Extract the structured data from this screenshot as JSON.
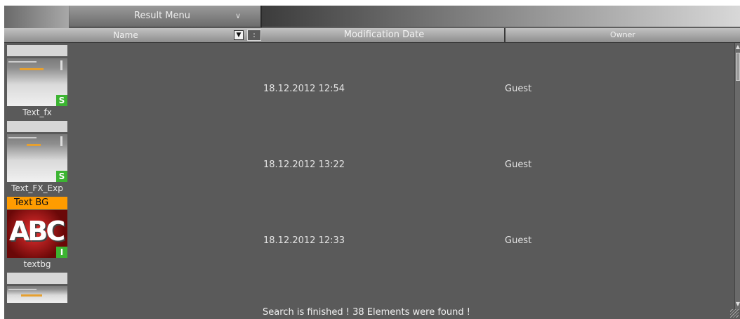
{
  "toolbar": {
    "result_menu_label": "Result Menu",
    "result_menu_icon": "chevron-down-icon"
  },
  "columns": {
    "name": "Name",
    "sort_icon": "triangle-down-icon",
    "modification_date": "Modification Date",
    "owner": "Owner"
  },
  "items": [
    {
      "caption": "Text_fx",
      "badge": "S",
      "date": "18.12.2012 12:54",
      "owner": "Guest"
    },
    {
      "caption": "Text_FX_Exp",
      "badge": "S",
      "date": "18.12.2012 13:22",
      "owner": "Guest"
    },
    {
      "caption": "textbg",
      "badge": "I",
      "top_label": "Text BG",
      "thumb_text": "ABC",
      "date": "18.12.2012 12:33",
      "owner": "Guest"
    }
  ],
  "status": "Search is finished ! 38 Elements were found !",
  "colors": {
    "panel_bg": "#5a5a5a",
    "accent_orange": "#ff9c00",
    "badge_green": "#3cb432"
  }
}
